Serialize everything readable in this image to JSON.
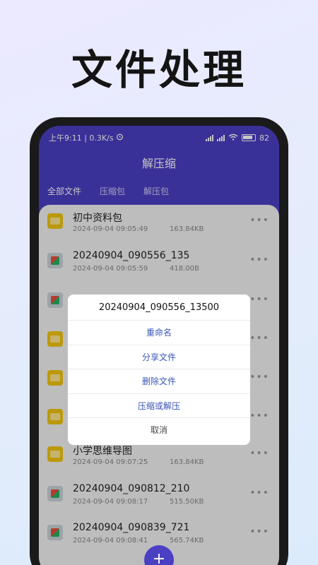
{
  "headline": "文件处理",
  "status_bar": {
    "time_speed": "上午9:11 | 0.3K/s",
    "alarm_icon": "alarm-clock-icon",
    "battery": "82"
  },
  "app": {
    "title": "解压缩",
    "tabs": [
      {
        "label": "全部文件",
        "active": true
      },
      {
        "label": "压缩包",
        "active": false
      },
      {
        "label": "解压包",
        "active": false
      }
    ],
    "accent_color": "#4b3fc3"
  },
  "files": [
    {
      "name": "初中资料包",
      "date": "2024-09-04 09:05:49",
      "size": "163.84KB",
      "icon": "folder-icon"
    },
    {
      "name": "20240904_090556_135",
      "date": "2024-09-04 09:05:59",
      "size": "418.00B",
      "icon": "archive-icon"
    },
    {
      "name": "",
      "date": "",
      "size": "",
      "icon": "archive-icon"
    },
    {
      "name": "",
      "date": "",
      "size": "",
      "icon": "folder-icon"
    },
    {
      "name": "",
      "date": "",
      "size": "",
      "icon": "folder-icon"
    },
    {
      "name": "",
      "date": "",
      "size": "",
      "icon": "folder-icon"
    },
    {
      "name": "小学思维导图",
      "date": "2024-09-04 09:07:25",
      "size": "163.84KB",
      "icon": "folder-icon"
    },
    {
      "name": "20240904_090812_210",
      "date": "2024-09-04 09:08:17",
      "size": "515.50KB",
      "icon": "archive-icon"
    },
    {
      "name": "20240904_090839_721",
      "date": "2024-09-04 09:08:41",
      "size": "565.74KB",
      "icon": "archive-icon"
    }
  ],
  "dialog": {
    "title": "20240904_090556_13500",
    "options": [
      "重命名",
      "分享文件",
      "删除文件",
      "压缩或解压"
    ],
    "cancel": "取消"
  },
  "fab": {
    "label": "+"
  }
}
